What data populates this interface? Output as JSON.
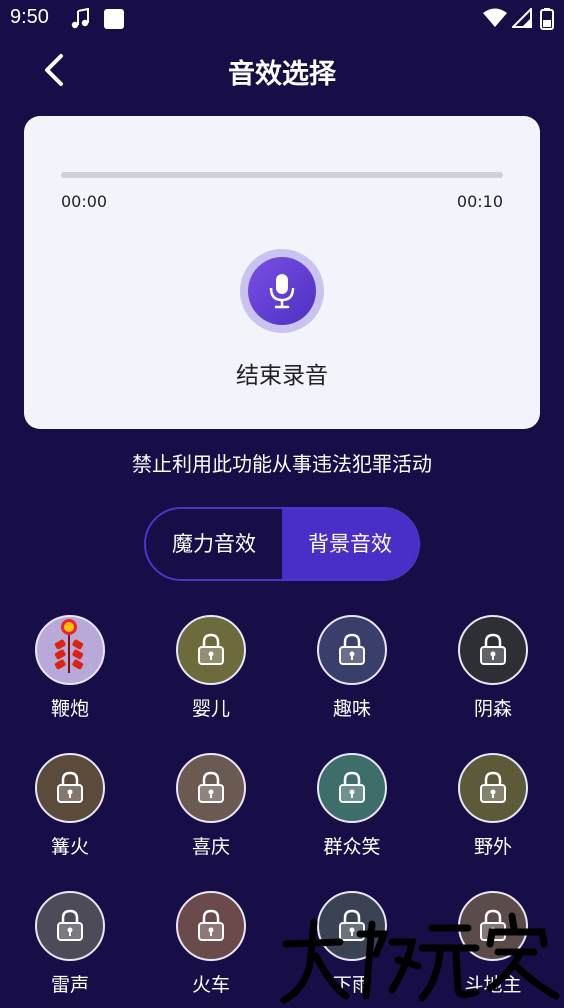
{
  "status_bar": {
    "time": "9:50"
  },
  "header": {
    "title": "音效选择"
  },
  "recorder": {
    "time_start": "00:00",
    "time_end": "00:10",
    "progress": 0,
    "action_label": "结束录音"
  },
  "notice": "禁止利用此功能从事违法犯罪活动",
  "tabs": [
    {
      "label": "魔力音效",
      "selected": false
    },
    {
      "label": "背景音效",
      "selected": true
    }
  ],
  "effects": [
    {
      "label": "鞭炮",
      "locked": false,
      "bg": "#b8a9d8",
      "icon": "firecracker-icon"
    },
    {
      "label": "婴儿",
      "locked": true,
      "bg": "#6d6a3c",
      "icon": "baby-icon"
    },
    {
      "label": "趣味",
      "locked": true,
      "bg": "#3a3e6a",
      "icon": "funny-icon"
    },
    {
      "label": "阴森",
      "locked": true,
      "bg": "#2e2f35",
      "icon": "spooky-icon"
    },
    {
      "label": "篝火",
      "locked": true,
      "bg": "#5a4b3a",
      "icon": "bonfire-icon"
    },
    {
      "label": "喜庆",
      "locked": true,
      "bg": "#6b5a52",
      "icon": "festive-icon"
    },
    {
      "label": "群众笑",
      "locked": true,
      "bg": "#3d6e6a",
      "icon": "crowd-laugh-icon"
    },
    {
      "label": "野外",
      "locked": true,
      "bg": "#5d5a3a",
      "icon": "outdoor-icon"
    },
    {
      "label": "雷声",
      "locked": true,
      "bg": "#4e4b58",
      "icon": "thunder-icon"
    },
    {
      "label": "火车",
      "locked": true,
      "bg": "#6a4a4a",
      "icon": "train-icon"
    },
    {
      "label": "下雨",
      "locked": true,
      "bg": "#3b4254",
      "icon": "rain-icon"
    },
    {
      "label": "斗地主",
      "locked": true,
      "bg": "#5b4b4b",
      "icon": "cards-icon"
    }
  ],
  "colors": {
    "background": "#170d47",
    "accent": "#4a2ec8",
    "card": "#f2f3fb"
  }
}
